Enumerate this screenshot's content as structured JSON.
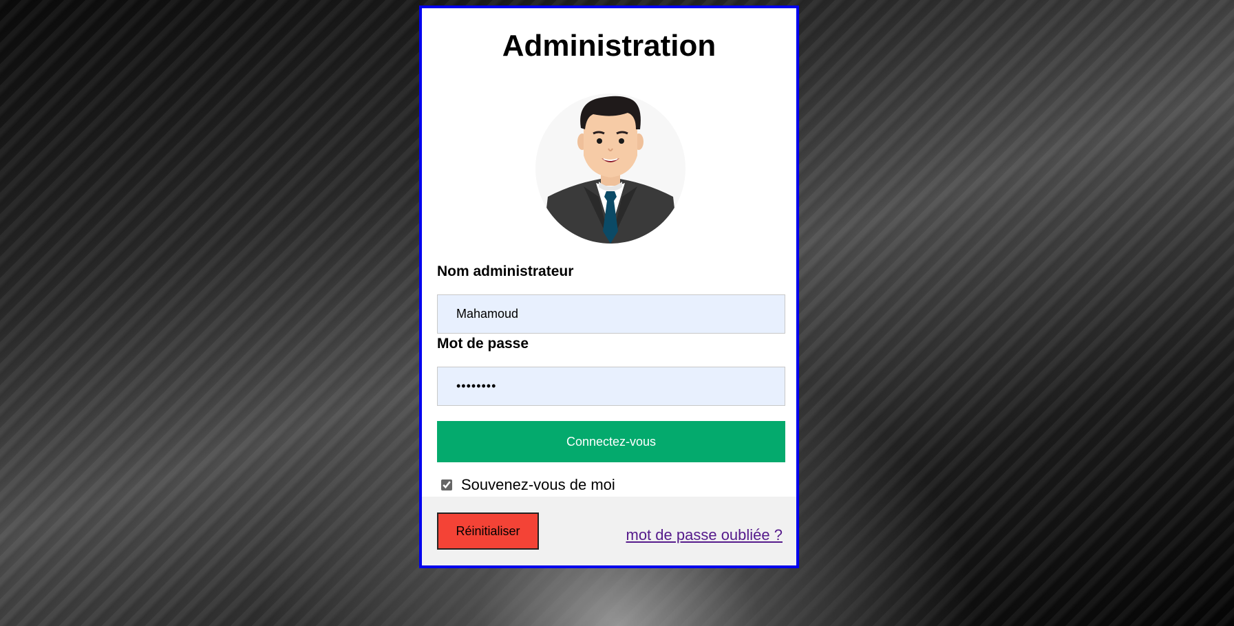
{
  "login": {
    "title": "Administration",
    "avatar_icon": "admin-avatar-icon",
    "username_label": "Nom administrateur",
    "username_value": "Mahamoud",
    "password_label": "Mot de passe",
    "password_value": "••••••••",
    "submit_label": "Connectez-vous",
    "remember_label": "Souvenez-vous de moi",
    "remember_checked": true,
    "reset_label": "Réinitialiser",
    "forgot_label": "mot de passe oubliée ?"
  },
  "colors": {
    "card_border": "#0000ee",
    "submit_bg": "#04aa6d",
    "reset_bg": "#f44336",
    "field_bg": "#e8f0fe",
    "link": "#551a8b"
  }
}
